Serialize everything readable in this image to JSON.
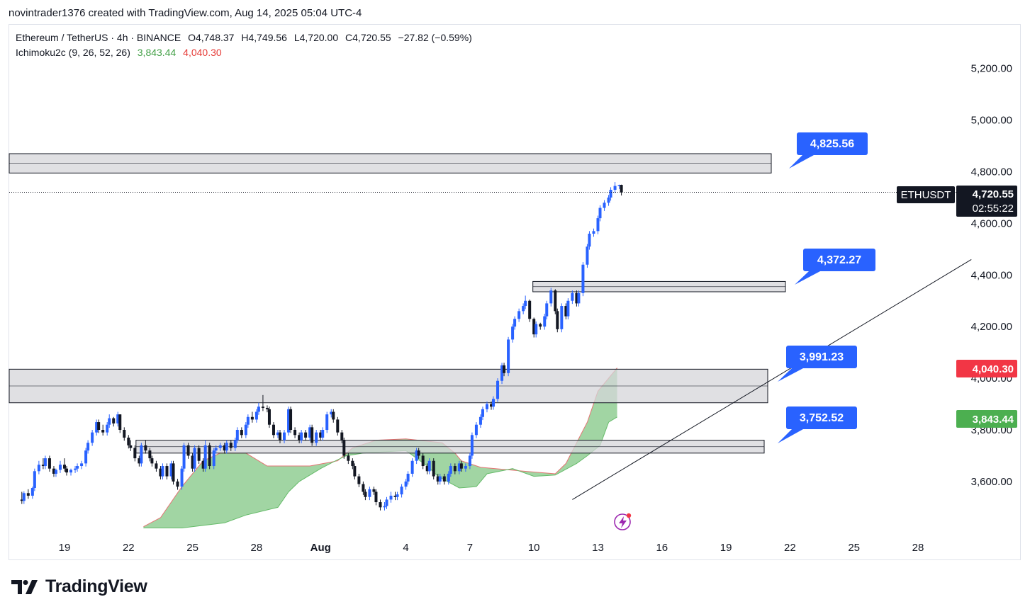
{
  "attribution": "novintrader1376 created with TradingView.com, Aug 14, 2025 05:04 UTC-4",
  "legend": {
    "symbol": "Ethereum / TetherUS · 4h · BINANCE",
    "open": "O4,748.37",
    "high": "H4,749.56",
    "low": "L4,720.00",
    "close": "C4,720.55",
    "change": "−27.82 (−0.59%)",
    "indicator": "Ichimoku2c (9, 26, 52, 26)",
    "ind_value_1": "3,843.44",
    "ind_value_2": "4,040.30"
  },
  "brand": "TradingView",
  "colors": {
    "up": "#2962ff",
    "down": "#131722",
    "cloud_fill": "#81c784",
    "cloud_edge": "#e57373",
    "zone_fill": "#d6d6d9",
    "callout": "#2962ff",
    "badge_red": "#f23645",
    "badge_green": "#4caf50",
    "price_badge": "#131722"
  },
  "chart_data": {
    "type": "candlestick",
    "symbol": "ETHUSDT",
    "timeframe": "4h",
    "y_ticks": [
      "5,200.00",
      "5,000.00",
      "4,800.00",
      "4,600.00",
      "4,400.00",
      "4,200.00",
      "4,000.00",
      "3,800.00",
      "3,600.00"
    ],
    "x_ticks": [
      "19",
      "22",
      "25",
      "28",
      "Aug",
      "4",
      "7",
      "10",
      "13",
      "16",
      "19",
      "22",
      "25",
      "28"
    ],
    "last_price": {
      "label": "ETHUSDT",
      "value": "4,720.55",
      "countdown": "02:55:22",
      "y": 4720.55
    },
    "indicator_badges": [
      {
        "value": "4,040.30",
        "y": 4040.3,
        "color": "red"
      },
      {
        "value": "3,843.44",
        "y": 3843.44,
        "color": "green"
      }
    ],
    "callouts": [
      {
        "value": "4,825.56",
        "y": 4825.56
      },
      {
        "value": "4,372.27",
        "y": 4372.27
      },
      {
        "value": "3,991.23",
        "y": 3991.23
      },
      {
        "value": "3,752.52",
        "y": 3752.52
      }
    ],
    "zones": [
      {
        "from": 4795,
        "to": 4870,
        "x_start": 16.0,
        "x_end": 52.0
      },
      {
        "from": 4335,
        "to": 4375,
        "x_start": 42.0,
        "x_end": 52.0
      },
      {
        "from": 3905,
        "to": 4035,
        "x_start": 16.0,
        "x_end": 52.0
      },
      {
        "from": 3710,
        "to": 3760,
        "x_start": 23.0,
        "x_end": 52.0
      }
    ],
    "trendline": [
      {
        "x": 42.8,
        "y": 3530
      },
      {
        "x": 61.5,
        "y": 4460
      }
    ],
    "candles": [
      [
        17.0,
        3530,
        3525,
        3560
      ],
      [
        17.1,
        3525,
        3555,
        3562
      ],
      [
        17.3,
        3555,
        3545,
        3570
      ],
      [
        17.5,
        3545,
        3575,
        3580
      ],
      [
        17.6,
        3575,
        3640,
        3650
      ],
      [
        17.8,
        3640,
        3665,
        3680
      ],
      [
        18.0,
        3665,
        3660,
        3690
      ],
      [
        18.1,
        3660,
        3690,
        3700
      ],
      [
        18.3,
        3690,
        3650,
        3700
      ],
      [
        18.5,
        3650,
        3630,
        3660
      ],
      [
        18.6,
        3630,
        3645,
        3650
      ],
      [
        18.8,
        3645,
        3665,
        3680
      ],
      [
        19.0,
        3665,
        3650,
        3690
      ],
      [
        19.1,
        3650,
        3635,
        3660
      ],
      [
        19.3,
        3635,
        3645,
        3650
      ],
      [
        19.5,
        3645,
        3650,
        3660
      ],
      [
        19.6,
        3650,
        3660,
        3670
      ],
      [
        19.8,
        3660,
        3670,
        3680
      ],
      [
        20.0,
        3670,
        3720,
        3730
      ],
      [
        20.1,
        3720,
        3750,
        3760
      ],
      [
        20.3,
        3750,
        3790,
        3800
      ],
      [
        20.5,
        3790,
        3830,
        3840
      ],
      [
        20.6,
        3830,
        3800,
        3840
      ],
      [
        20.8,
        3800,
        3790,
        3820
      ],
      [
        21.0,
        3790,
        3820,
        3830
      ],
      [
        21.1,
        3820,
        3845,
        3860
      ],
      [
        21.3,
        3845,
        3825,
        3850
      ],
      [
        21.5,
        3825,
        3860,
        3870
      ],
      [
        21.6,
        3860,
        3800,
        3860
      ],
      [
        21.8,
        3800,
        3770,
        3810
      ],
      [
        22.0,
        3770,
        3740,
        3780
      ],
      [
        22.1,
        3740,
        3730,
        3760
      ],
      [
        22.3,
        3730,
        3690,
        3740
      ],
      [
        22.5,
        3690,
        3670,
        3700
      ],
      [
        22.6,
        3670,
        3740,
        3750
      ],
      [
        22.8,
        3740,
        3720,
        3760
      ],
      [
        23.0,
        3720,
        3690,
        3730
      ],
      [
        23.1,
        3690,
        3670,
        3700
      ],
      [
        23.3,
        3670,
        3650,
        3680
      ],
      [
        23.5,
        3650,
        3620,
        3660
      ],
      [
        23.6,
        3620,
        3660,
        3670
      ],
      [
        23.8,
        3660,
        3620,
        3670
      ],
      [
        24.0,
        3620,
        3670,
        3680
      ],
      [
        24.1,
        3670,
        3600,
        3680
      ],
      [
        24.3,
        3600,
        3580,
        3610
      ],
      [
        24.5,
        3580,
        3650,
        3660
      ],
      [
        24.6,
        3650,
        3740,
        3750
      ],
      [
        24.8,
        3740,
        3700,
        3750
      ],
      [
        25.0,
        3700,
        3650,
        3710
      ],
      [
        25.1,
        3650,
        3730,
        3740
      ],
      [
        25.3,
        3730,
        3680,
        3740
      ],
      [
        25.5,
        3680,
        3650,
        3690
      ],
      [
        25.6,
        3650,
        3740,
        3760
      ],
      [
        25.8,
        3740,
        3660,
        3750
      ],
      [
        26.0,
        3660,
        3720,
        3730
      ],
      [
        26.1,
        3720,
        3730,
        3740
      ],
      [
        26.3,
        3730,
        3740,
        3750
      ],
      [
        26.5,
        3740,
        3720,
        3750
      ],
      [
        26.6,
        3720,
        3750,
        3760
      ],
      [
        26.8,
        3750,
        3730,
        3760
      ],
      [
        27.0,
        3730,
        3760,
        3770
      ],
      [
        27.1,
        3760,
        3800,
        3810
      ],
      [
        27.3,
        3800,
        3780,
        3810
      ],
      [
        27.5,
        3780,
        3820,
        3830
      ],
      [
        27.6,
        3820,
        3850,
        3860
      ],
      [
        27.8,
        3850,
        3840,
        3870
      ],
      [
        28.0,
        3840,
        3870,
        3880
      ],
      [
        28.1,
        3870,
        3890,
        3905
      ],
      [
        28.3,
        3890,
        3885,
        3935
      ],
      [
        28.5,
        3885,
        3880,
        3895
      ],
      [
        28.6,
        3880,
        3820,
        3890
      ],
      [
        28.8,
        3820,
        3780,
        3830
      ],
      [
        29.0,
        3780,
        3790,
        3800
      ],
      [
        29.1,
        3790,
        3760,
        3800
      ],
      [
        29.3,
        3760,
        3790,
        3800
      ],
      [
        29.5,
        3790,
        3880,
        3890
      ],
      [
        29.6,
        3880,
        3800,
        3890
      ],
      [
        29.8,
        3800,
        3780,
        3810
      ],
      [
        30.0,
        3780,
        3760,
        3790
      ],
      [
        30.1,
        3760,
        3790,
        3800
      ],
      [
        30.3,
        3790,
        3770,
        3800
      ],
      [
        30.5,
        3770,
        3810,
        3820
      ],
      [
        30.6,
        3810,
        3750,
        3820
      ],
      [
        30.8,
        3750,
        3790,
        3800
      ],
      [
        31.0,
        3790,
        3770,
        3800
      ],
      [
        31.1,
        3770,
        3800,
        3810
      ],
      [
        31.3,
        3800,
        3860,
        3870
      ],
      [
        31.5,
        3860,
        3870,
        3880
      ],
      [
        31.6,
        3870,
        3840,
        3880
      ],
      [
        31.8,
        3840,
        3790,
        3850
      ],
      [
        32.0,
        3790,
        3760,
        3800
      ],
      [
        32.1,
        3760,
        3700,
        3770
      ],
      [
        32.3,
        3700,
        3680,
        3710
      ],
      [
        32.5,
        3680,
        3660,
        3690
      ],
      [
        32.6,
        3660,
        3620,
        3670
      ],
      [
        32.8,
        3620,
        3590,
        3630
      ],
      [
        33.0,
        3590,
        3560,
        3600
      ],
      [
        33.1,
        3560,
        3540,
        3570
      ],
      [
        33.3,
        3540,
        3570,
        3580
      ],
      [
        33.5,
        3570,
        3560,
        3580
      ],
      [
        33.6,
        3560,
        3520,
        3570
      ],
      [
        33.8,
        3520,
        3500,
        3530
      ],
      [
        34.0,
        3500,
        3505,
        3520
      ],
      [
        34.1,
        3505,
        3530,
        3540
      ],
      [
        34.3,
        3530,
        3545,
        3560
      ],
      [
        34.5,
        3545,
        3540,
        3560
      ],
      [
        34.6,
        3540,
        3550,
        3560
      ],
      [
        34.8,
        3550,
        3580,
        3590
      ],
      [
        35.0,
        3580,
        3600,
        3610
      ],
      [
        35.1,
        3600,
        3630,
        3640
      ],
      [
        35.3,
        3630,
        3680,
        3690
      ],
      [
        35.5,
        3680,
        3720,
        3730
      ],
      [
        35.6,
        3720,
        3700,
        3730
      ],
      [
        35.8,
        3700,
        3660,
        3710
      ],
      [
        36.0,
        3660,
        3640,
        3670
      ],
      [
        36.1,
        3640,
        3680,
        3690
      ],
      [
        36.3,
        3680,
        3620,
        3690
      ],
      [
        36.5,
        3620,
        3600,
        3630
      ],
      [
        36.6,
        3600,
        3620,
        3630
      ],
      [
        36.8,
        3620,
        3600,
        3630
      ],
      [
        37.0,
        3600,
        3630,
        3640
      ],
      [
        37.1,
        3630,
        3660,
        3670
      ],
      [
        37.3,
        3660,
        3640,
        3670
      ],
      [
        37.5,
        3640,
        3670,
        3680
      ],
      [
        37.6,
        3670,
        3650,
        3680
      ],
      [
        37.8,
        3650,
        3660,
        3670
      ],
      [
        38.0,
        3660,
        3700,
        3710
      ],
      [
        38.1,
        3700,
        3780,
        3790
      ],
      [
        38.3,
        3780,
        3820,
        3830
      ],
      [
        38.5,
        3820,
        3850,
        3860
      ],
      [
        38.6,
        3850,
        3880,
        3890
      ],
      [
        38.8,
        3880,
        3900,
        3910
      ],
      [
        39.0,
        3900,
        3890,
        3910
      ],
      [
        39.1,
        3890,
        3920,
        3930
      ],
      [
        39.3,
        3920,
        3990,
        4000
      ],
      [
        39.5,
        3990,
        4050,
        4060
      ],
      [
        39.6,
        4050,
        4020,
        4060
      ],
      [
        39.8,
        4020,
        4150,
        4160
      ],
      [
        40.0,
        4150,
        4200,
        4210
      ],
      [
        40.1,
        4200,
        4230,
        4240
      ],
      [
        40.3,
        4230,
        4260,
        4270
      ],
      [
        40.5,
        4260,
        4280,
        4290
      ],
      [
        40.6,
        4280,
        4300,
        4320
      ],
      [
        40.8,
        4300,
        4230,
        4305
      ],
      [
        41.0,
        4230,
        4170,
        4235
      ],
      [
        41.1,
        4170,
        4210,
        4220
      ],
      [
        41.3,
        4210,
        4200,
        4215
      ],
      [
        41.5,
        4200,
        4240,
        4250
      ],
      [
        41.6,
        4240,
        4290,
        4300
      ],
      [
        41.8,
        4290,
        4340,
        4350
      ],
      [
        42.0,
        4340,
        4260,
        4345
      ],
      [
        42.1,
        4260,
        4190,
        4270
      ],
      [
        42.3,
        4190,
        4280,
        4290
      ],
      [
        42.5,
        4280,
        4240,
        4290
      ],
      [
        42.6,
        4240,
        4300,
        4310
      ],
      [
        42.8,
        4300,
        4330,
        4340
      ],
      [
        43.0,
        4330,
        4290,
        4340
      ],
      [
        43.1,
        4290,
        4330,
        4340
      ],
      [
        43.3,
        4330,
        4440,
        4450
      ],
      [
        43.5,
        4440,
        4510,
        4520
      ],
      [
        43.6,
        4510,
        4560,
        4570
      ],
      [
        43.8,
        4560,
        4570,
        4580
      ],
      [
        44.0,
        4570,
        4620,
        4630
      ],
      [
        44.1,
        4620,
        4660,
        4670
      ],
      [
        44.3,
        4660,
        4680,
        4690
      ],
      [
        44.5,
        4680,
        4700,
        4710
      ],
      [
        44.6,
        4700,
        4730,
        4740
      ],
      [
        44.8,
        4730,
        4745,
        4760
      ],
      [
        45.0,
        4745,
        4749,
        4750
      ],
      [
        45.1,
        4749,
        4720,
        4750
      ]
    ]
  }
}
